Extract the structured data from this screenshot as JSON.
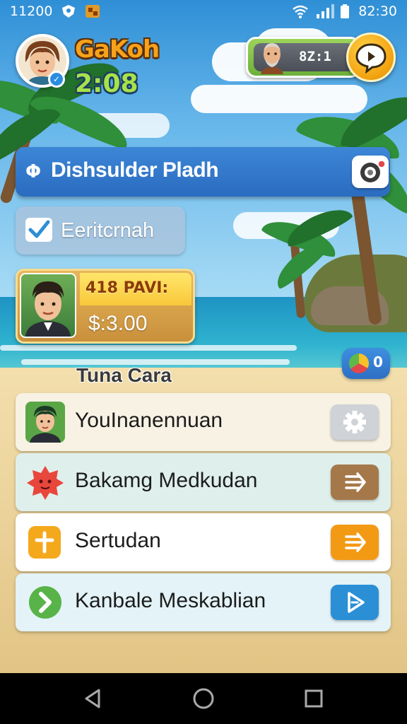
{
  "status_bar": {
    "time_left": "11200",
    "time_right": "82:30"
  },
  "header": {
    "player_name": "GaKoh",
    "timer": "2:08",
    "coin_value": "8Z:1"
  },
  "banner": {
    "icon_glyph": "Φ",
    "title": "Dishsulder Pladh"
  },
  "checkbox": {
    "label": "Eeritcrnah"
  },
  "profile_card": {
    "name": "418 PAVI:",
    "money": "$:3.00"
  },
  "section": {
    "title": "Tuna Cara",
    "badge_count": "0"
  },
  "list": {
    "items": [
      {
        "label": "YouInanennuan",
        "button": "gear-icon"
      },
      {
        "label": "Bakamg Medkudan",
        "button": "forward-icon"
      },
      {
        "label": "Sertudan",
        "button": "forward-icon"
      },
      {
        "label": "Kanbale Meskablian",
        "button": "play-icon"
      }
    ]
  },
  "colors": {
    "banner_blue": "#2a6cc0",
    "gold": "#f2a10e",
    "green": "#6cb03a",
    "row_brown_btn": "#a5784a",
    "row_orange_btn": "#f39a14",
    "row_blue_btn": "#2b8fd6"
  }
}
